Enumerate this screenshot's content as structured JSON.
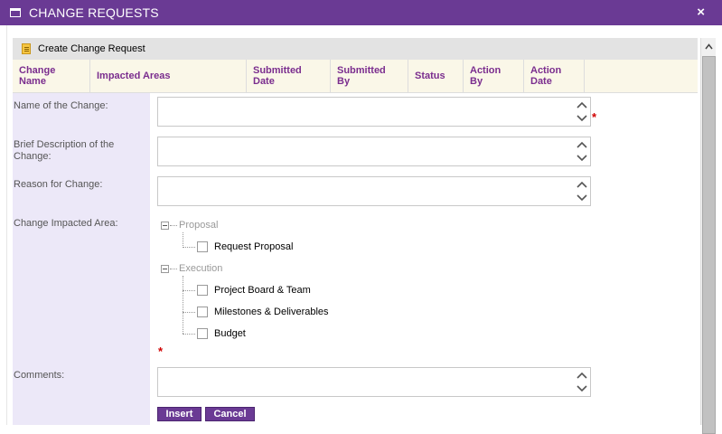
{
  "window": {
    "title": "CHANGE REQUESTS",
    "close_glyph": "×"
  },
  "panel": {
    "header": "Create Change Request"
  },
  "grid": {
    "columns": [
      {
        "line1": "Change",
        "line2": "Name"
      },
      {
        "line1": "Impacted Areas",
        "line2": ""
      },
      {
        "line1": "Submitted",
        "line2": "Date"
      },
      {
        "line1": "Submitted",
        "line2": "By"
      },
      {
        "line1": "Status",
        "line2": ""
      },
      {
        "line1": "Action",
        "line2": "By"
      },
      {
        "line1": "Action",
        "line2": "Date"
      }
    ]
  },
  "form": {
    "name_label": "Name of the Change:",
    "name_value": "",
    "description_label_line1": "Brief Description of the",
    "description_label_line2": "Change:",
    "description_value": "",
    "reason_label": "Reason for Change:",
    "reason_value": "",
    "impacted_label": "Change Impacted Area:",
    "comments_label": "Comments:",
    "comments_value": "",
    "required_mark": "*"
  },
  "tree": {
    "proposal": {
      "label": "Proposal",
      "items": [
        "Request Proposal"
      ]
    },
    "execution": {
      "label": "Execution",
      "items": [
        "Project Board & Team",
        "Milestones & Deliverables",
        "Budget"
      ]
    }
  },
  "buttons": {
    "insert": "Insert",
    "cancel": "Cancel"
  },
  "colors": {
    "titlebar": "#6a3a94",
    "header_text": "#7a2d8e",
    "form_label_bg": "#ece8f8",
    "required": "#d00000"
  }
}
